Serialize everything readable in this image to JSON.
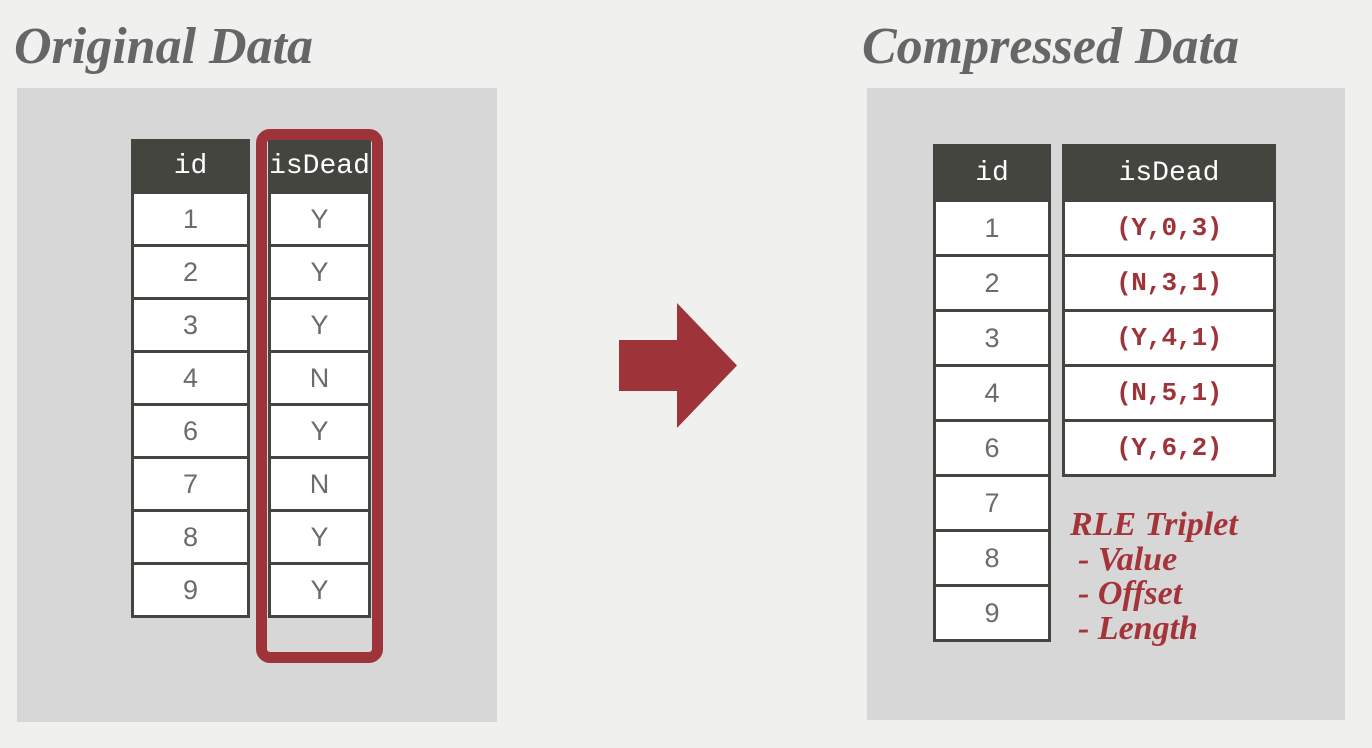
{
  "page": {
    "background_color": "#f0f0ef",
    "panel_color": "#d7d7d7",
    "accent_red": "#9e3339",
    "header_dark": "#45453f",
    "text_gray": "#6b6b6b",
    "title_gray": "#666666"
  },
  "original": {
    "title": "Original Data",
    "columns": [
      "id",
      "isDead"
    ],
    "rows": [
      {
        "id": "1",
        "isDead": "Y"
      },
      {
        "id": "2",
        "isDead": "Y"
      },
      {
        "id": "3",
        "isDead": "Y"
      },
      {
        "id": "4",
        "isDead": "N"
      },
      {
        "id": "6",
        "isDead": "Y"
      },
      {
        "id": "7",
        "isDead": "N"
      },
      {
        "id": "8",
        "isDead": "Y"
      },
      {
        "id": "9",
        "isDead": "Y"
      }
    ],
    "highlight_column": "isDead",
    "highlight_color": "#9e3339"
  },
  "compressed": {
    "title": "Compressed Data",
    "columns": [
      "id",
      "isDead"
    ],
    "id_values": [
      "1",
      "2",
      "3",
      "4",
      "6",
      "7",
      "8",
      "9"
    ],
    "isdead_values": [
      "(Y,0,3)",
      "(N,3,1)",
      "(Y,4,1)",
      "(N,5,1)",
      "(Y,6,2)"
    ],
    "legend": {
      "title": "RLE Triplet",
      "items": [
        "- Value",
        "- Offset",
        "- Length"
      ]
    }
  },
  "arrow": {
    "name": "right-arrow",
    "color": "#9e3339",
    "direction": "right"
  }
}
